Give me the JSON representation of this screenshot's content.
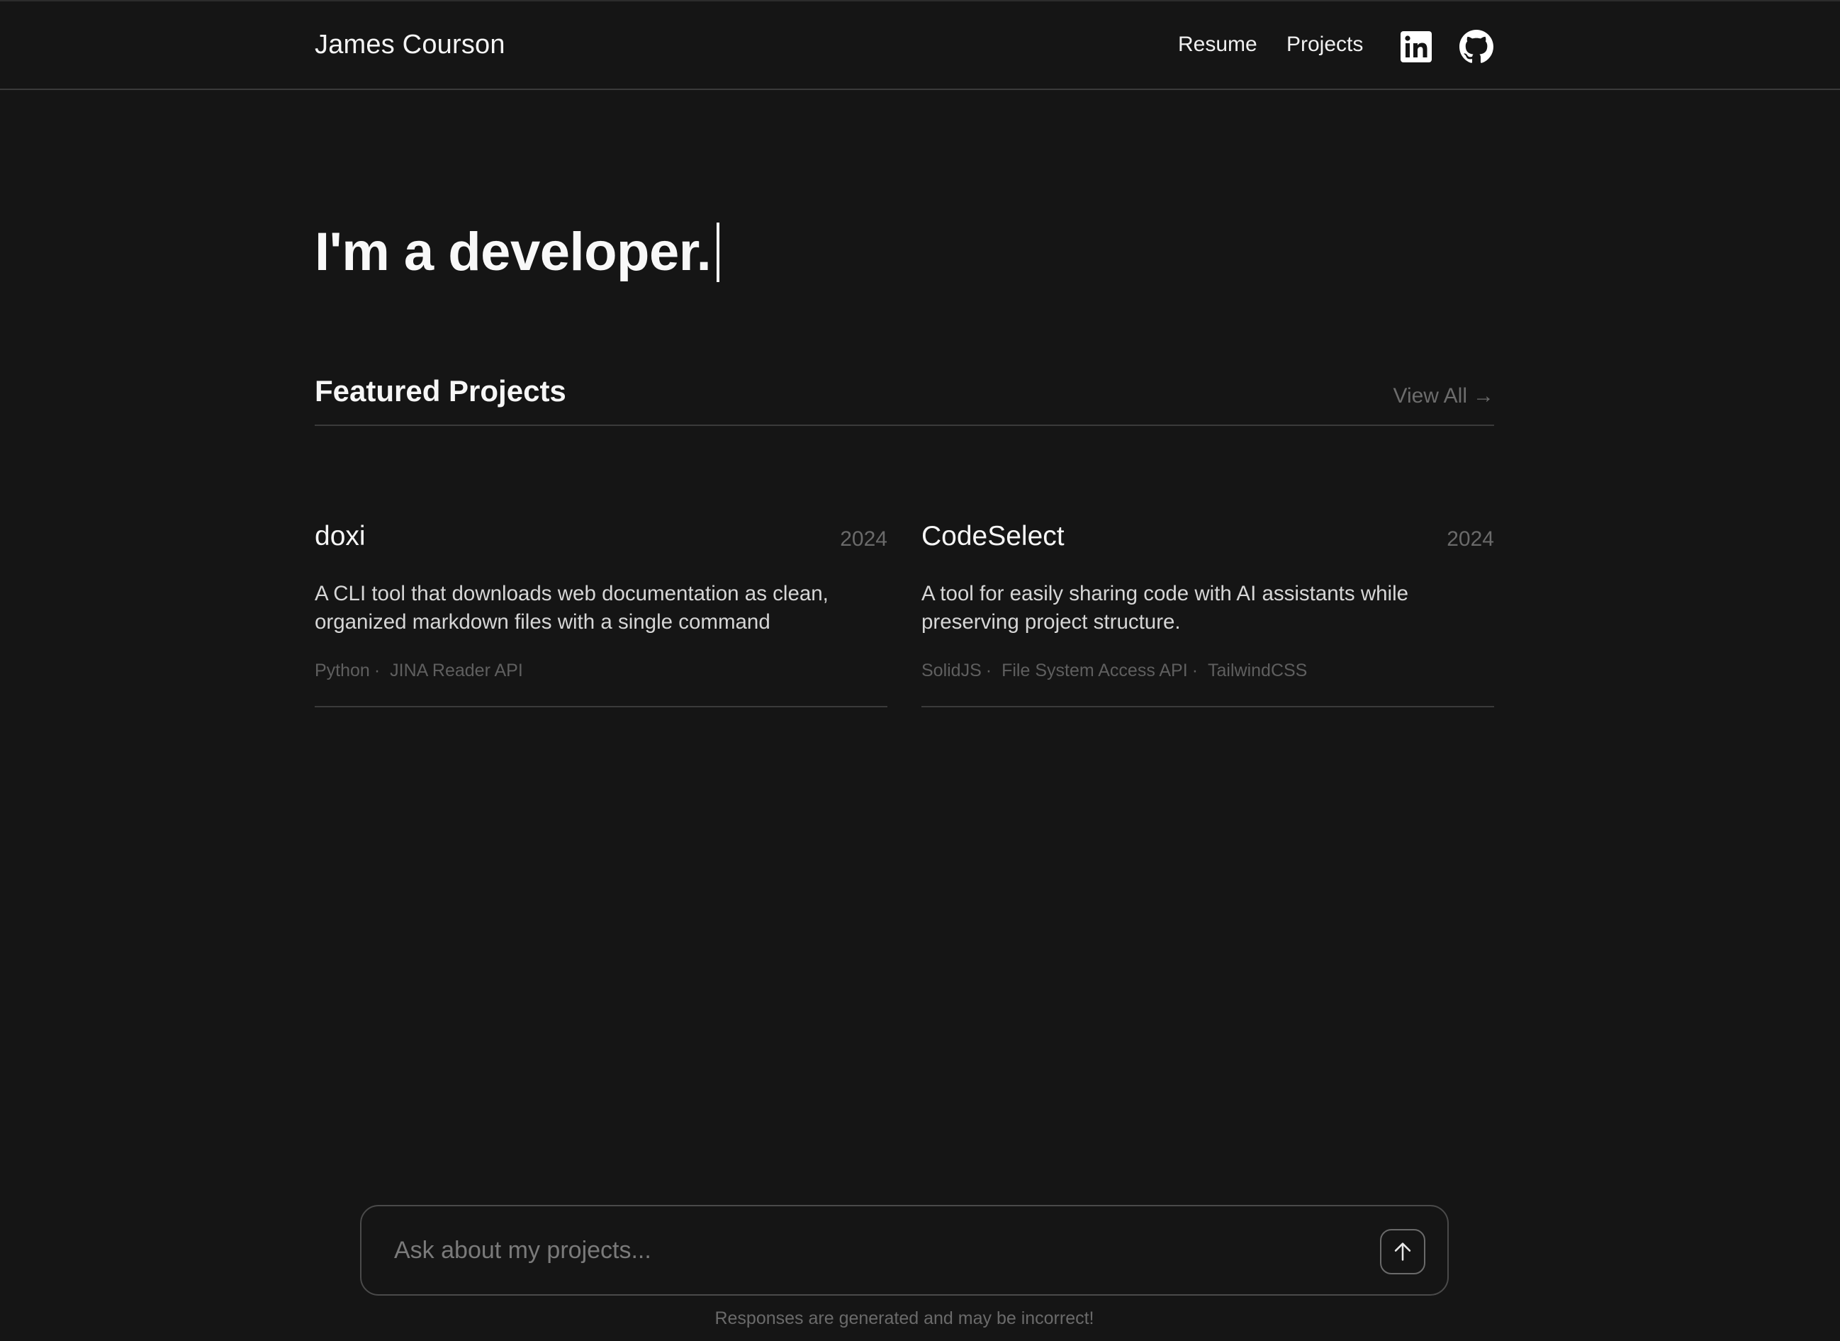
{
  "header": {
    "brand": "James Courson",
    "nav": {
      "resume": "Resume",
      "projects": "Projects"
    },
    "social": {
      "linkedin_icon": "linkedin-icon",
      "github_icon": "github-icon"
    }
  },
  "hero": {
    "text": "I'm a developer."
  },
  "featured": {
    "title": "Featured Projects",
    "view_all": "View All",
    "view_all_arrow": "→",
    "projects": [
      {
        "title": "doxi",
        "year": "2024",
        "description": "A CLI tool that downloads web documentation as clean, organized markdown files with a single command",
        "tags": [
          "Python",
          "JINA Reader API"
        ]
      },
      {
        "title": "CodeSelect",
        "year": "2024",
        "description": "A tool for easily sharing code with AI assistants while preserving project structure.",
        "tags": [
          "SolidJS",
          "File System Access API",
          "TailwindCSS"
        ]
      }
    ]
  },
  "chat": {
    "placeholder": "Ask about my projects...",
    "value": "",
    "send_icon": "arrow-up-icon",
    "disclaimer": "Responses are generated and may be incorrect!"
  },
  "colors": {
    "background": "#151515",
    "text": "#f2f2f2",
    "muted": "#6a6a6a",
    "divider": "#3a3a3a"
  }
}
